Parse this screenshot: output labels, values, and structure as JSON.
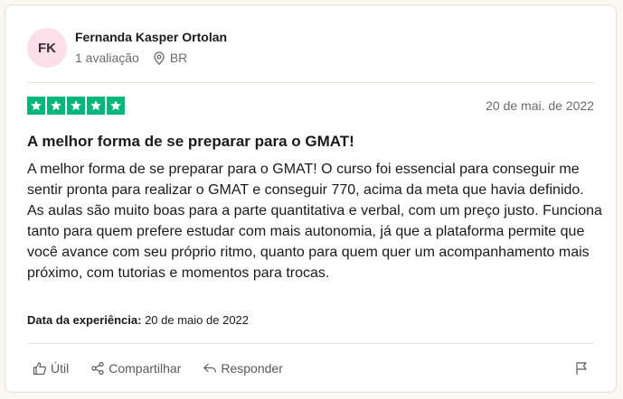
{
  "reviewer": {
    "initials": "FK",
    "name": "Fernanda Kasper Ortolan",
    "review_count": "1 avaliação",
    "country": "BR",
    "avatar_color": "#fbe0e9"
  },
  "review": {
    "rating": 5,
    "star_color": "#00b67a",
    "date": "20 de mai. de 2022",
    "title": "A melhor forma de se preparar para o GMAT!",
    "body_1": "A melhor forma de se preparar para o GMAT! O curso foi essencial para conseguir me sentir pronta para realizar o GMAT e conseguir 770, acima da meta que havia definido.",
    "body_2": "As aulas são muito boas para a parte quantitativa e verbal, com um preço justo. Funciona tanto para quem prefere estudar com mais autonomia, já que a plataforma permite que você avance com seu próprio ritmo, quanto para quem quer um acompanhamento mais próximo, com tutorias e momentos para trocas.",
    "experience_label": "Data da experiência:",
    "experience_date": "20 de maio de 2022"
  },
  "actions": {
    "useful": "Útil",
    "share": "Compartilhar",
    "reply": "Responder"
  },
  "icons": [
    "location-pin-icon",
    "star-icon",
    "thumbs-up-icon",
    "share-icon",
    "reply-icon",
    "flag-icon"
  ]
}
